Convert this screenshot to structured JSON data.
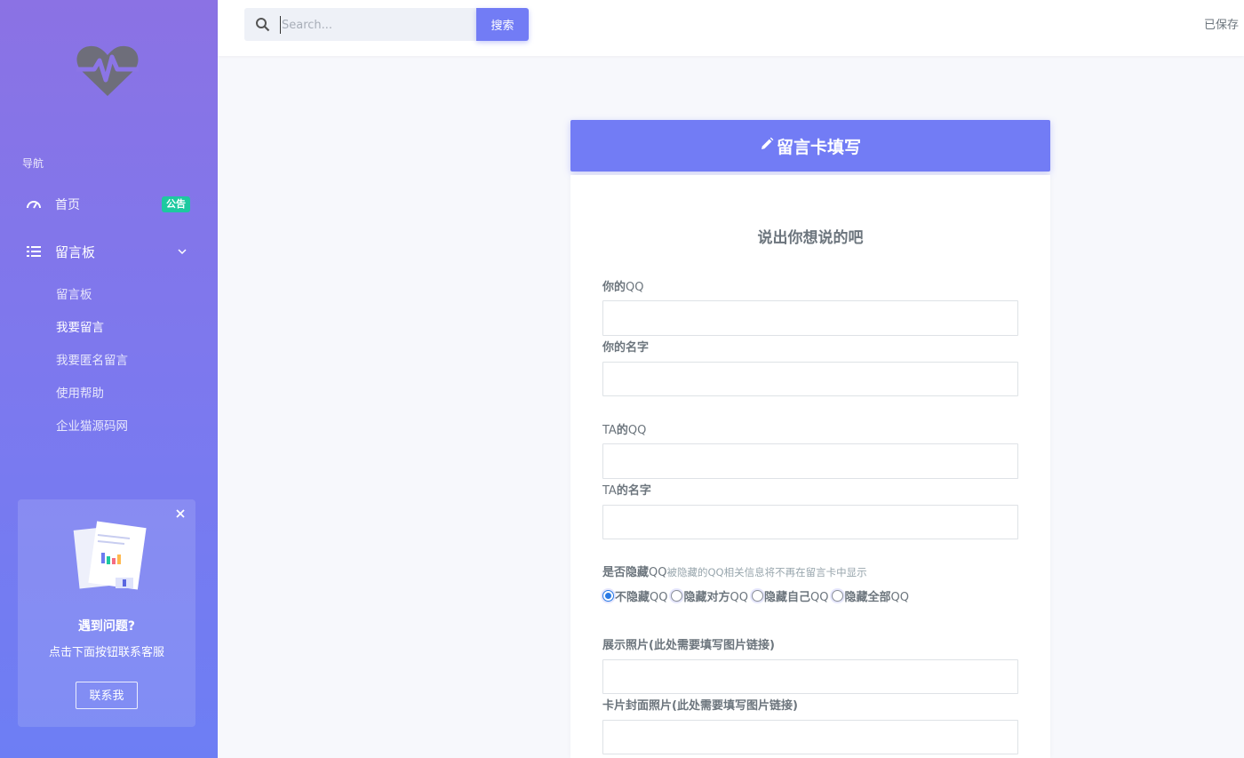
{
  "sidebar": {
    "nav_title": "导航",
    "items": [
      {
        "label": "首页",
        "icon": "dashboard-icon",
        "badge": "公告"
      },
      {
        "label": "留言板",
        "icon": "list-icon"
      }
    ],
    "sub_items": [
      "留言板",
      "我要留言",
      "我要匿名留言",
      "使用帮助",
      "企业猫源码网"
    ],
    "help": {
      "title": "遇到问题?",
      "desc": "点击下面按钮联系客服",
      "button": "联系我"
    }
  },
  "topbar": {
    "search_placeholder": "Search...",
    "search_button": "搜索",
    "saved_text": "已保存"
  },
  "card": {
    "header_title": "留言卡填写",
    "subtitle": "说出你想说的吧",
    "fields": {
      "your_qq_a": "你的",
      "your_qq_b": "QQ",
      "your_name": "你的名字",
      "ta_qq_a": "TA",
      "ta_qq_b": "的",
      "ta_qq_c": "QQ",
      "ta_name_a": "TA",
      "ta_name_b": "的名字",
      "hide_qq_a": "是否隐藏",
      "hide_qq_b": "QQ",
      "hide_qq_hint": "被隐藏的QQ相关信息将不再在留言卡中显示",
      "photo": "展示照片(此处需要填写图片链接)",
      "cover": "卡片封面照片(此处需要填写图片链接)"
    },
    "radio_options": [
      {
        "a": "不隐藏",
        "b": "QQ"
      },
      {
        "a": "隐藏对方",
        "b": "QQ"
      },
      {
        "a": "隐藏自己",
        "b": "QQ"
      },
      {
        "a": "隐藏全部",
        "b": "QQ"
      }
    ]
  },
  "colors": {
    "accent": "#727cf5",
    "badge": "#1dc9a0",
    "sidebar_top": "#8b72e4",
    "sidebar_bottom": "#6d7ef4"
  }
}
